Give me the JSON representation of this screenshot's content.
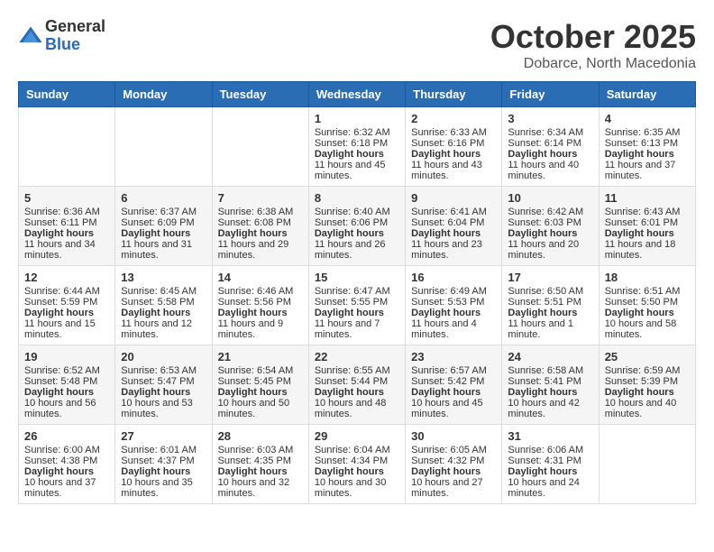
{
  "header": {
    "logo_general": "General",
    "logo_blue": "Blue",
    "month_title": "October 2025",
    "subtitle": "Dobarce, North Macedonia"
  },
  "weekdays": [
    "Sunday",
    "Monday",
    "Tuesday",
    "Wednesday",
    "Thursday",
    "Friday",
    "Saturday"
  ],
  "weeks": [
    [
      {
        "day": "",
        "content": ""
      },
      {
        "day": "",
        "content": ""
      },
      {
        "day": "",
        "content": ""
      },
      {
        "day": "1",
        "content": "Sunrise: 6:32 AM\nSunset: 6:18 PM\nDaylight: 11 hours and 45 minutes."
      },
      {
        "day": "2",
        "content": "Sunrise: 6:33 AM\nSunset: 6:16 PM\nDaylight: 11 hours and 43 minutes."
      },
      {
        "day": "3",
        "content": "Sunrise: 6:34 AM\nSunset: 6:14 PM\nDaylight: 11 hours and 40 minutes."
      },
      {
        "day": "4",
        "content": "Sunrise: 6:35 AM\nSunset: 6:13 PM\nDaylight: 11 hours and 37 minutes."
      }
    ],
    [
      {
        "day": "5",
        "content": "Sunrise: 6:36 AM\nSunset: 6:11 PM\nDaylight: 11 hours and 34 minutes."
      },
      {
        "day": "6",
        "content": "Sunrise: 6:37 AM\nSunset: 6:09 PM\nDaylight: 11 hours and 31 minutes."
      },
      {
        "day": "7",
        "content": "Sunrise: 6:38 AM\nSunset: 6:08 PM\nDaylight: 11 hours and 29 minutes."
      },
      {
        "day": "8",
        "content": "Sunrise: 6:40 AM\nSunset: 6:06 PM\nDaylight: 11 hours and 26 minutes."
      },
      {
        "day": "9",
        "content": "Sunrise: 6:41 AM\nSunset: 6:04 PM\nDaylight: 11 hours and 23 minutes."
      },
      {
        "day": "10",
        "content": "Sunrise: 6:42 AM\nSunset: 6:03 PM\nDaylight: 11 hours and 20 minutes."
      },
      {
        "day": "11",
        "content": "Sunrise: 6:43 AM\nSunset: 6:01 PM\nDaylight: 11 hours and 18 minutes."
      }
    ],
    [
      {
        "day": "12",
        "content": "Sunrise: 6:44 AM\nSunset: 5:59 PM\nDaylight: 11 hours and 15 minutes."
      },
      {
        "day": "13",
        "content": "Sunrise: 6:45 AM\nSunset: 5:58 PM\nDaylight: 11 hours and 12 minutes."
      },
      {
        "day": "14",
        "content": "Sunrise: 6:46 AM\nSunset: 5:56 PM\nDaylight: 11 hours and 9 minutes."
      },
      {
        "day": "15",
        "content": "Sunrise: 6:47 AM\nSunset: 5:55 PM\nDaylight: 11 hours and 7 minutes."
      },
      {
        "day": "16",
        "content": "Sunrise: 6:49 AM\nSunset: 5:53 PM\nDaylight: 11 hours and 4 minutes."
      },
      {
        "day": "17",
        "content": "Sunrise: 6:50 AM\nSunset: 5:51 PM\nDaylight: 11 hours and 1 minute."
      },
      {
        "day": "18",
        "content": "Sunrise: 6:51 AM\nSunset: 5:50 PM\nDaylight: 10 hours and 58 minutes."
      }
    ],
    [
      {
        "day": "19",
        "content": "Sunrise: 6:52 AM\nSunset: 5:48 PM\nDaylight: 10 hours and 56 minutes."
      },
      {
        "day": "20",
        "content": "Sunrise: 6:53 AM\nSunset: 5:47 PM\nDaylight: 10 hours and 53 minutes."
      },
      {
        "day": "21",
        "content": "Sunrise: 6:54 AM\nSunset: 5:45 PM\nDaylight: 10 hours and 50 minutes."
      },
      {
        "day": "22",
        "content": "Sunrise: 6:55 AM\nSunset: 5:44 PM\nDaylight: 10 hours and 48 minutes."
      },
      {
        "day": "23",
        "content": "Sunrise: 6:57 AM\nSunset: 5:42 PM\nDaylight: 10 hours and 45 minutes."
      },
      {
        "day": "24",
        "content": "Sunrise: 6:58 AM\nSunset: 5:41 PM\nDaylight: 10 hours and 42 minutes."
      },
      {
        "day": "25",
        "content": "Sunrise: 6:59 AM\nSunset: 5:39 PM\nDaylight: 10 hours and 40 minutes."
      }
    ],
    [
      {
        "day": "26",
        "content": "Sunrise: 6:00 AM\nSunset: 4:38 PM\nDaylight: 10 hours and 37 minutes."
      },
      {
        "day": "27",
        "content": "Sunrise: 6:01 AM\nSunset: 4:37 PM\nDaylight: 10 hours and 35 minutes."
      },
      {
        "day": "28",
        "content": "Sunrise: 6:03 AM\nSunset: 4:35 PM\nDaylight: 10 hours and 32 minutes."
      },
      {
        "day": "29",
        "content": "Sunrise: 6:04 AM\nSunset: 4:34 PM\nDaylight: 10 hours and 30 minutes."
      },
      {
        "day": "30",
        "content": "Sunrise: 6:05 AM\nSunset: 4:32 PM\nDaylight: 10 hours and 27 minutes."
      },
      {
        "day": "31",
        "content": "Sunrise: 6:06 AM\nSunset: 4:31 PM\nDaylight: 10 hours and 24 minutes."
      },
      {
        "day": "",
        "content": ""
      }
    ]
  ]
}
